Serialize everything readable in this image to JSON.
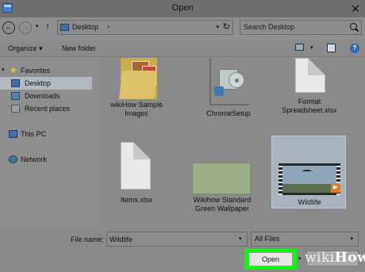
{
  "window": {
    "title": "Open",
    "close_glyph": "✕"
  },
  "address": {
    "location": "Desktop",
    "chevron": "›",
    "dropdown_glyph": "▾",
    "refresh_glyph": "↻"
  },
  "nav_buttons": {
    "back_glyph": "←",
    "forward_glyph": "→",
    "recent_glyph": "▾",
    "up_glyph": "↑"
  },
  "search": {
    "placeholder": "Search Desktop"
  },
  "toolbar": {
    "organize_label": "Organize",
    "organize_caret": "▾",
    "new_folder_label": "New folder",
    "view_drop_glyph": "▾",
    "help_glyph": "?"
  },
  "sidebar": {
    "items": [
      {
        "label": "Favorites",
        "caret": "▾",
        "icon": "★"
      },
      {
        "label": "Desktop"
      },
      {
        "label": "Downloads"
      },
      {
        "label": "Recent places"
      },
      {
        "label": "This PC"
      },
      {
        "label": "Network"
      }
    ]
  },
  "files": [
    {
      "name": "wikiHow Sample Images",
      "type": "folder"
    },
    {
      "name": "ChromeSetup",
      "type": "installer"
    },
    {
      "name": "Format Spreadsheet.xlsx",
      "type": "document"
    },
    {
      "name": "Items.xlsx",
      "type": "document"
    },
    {
      "name": "Wikihow Standard Green Wallpaper",
      "type": "image"
    },
    {
      "name": "Wildlife",
      "type": "video",
      "selected": true,
      "play_glyph": "▶"
    }
  ],
  "bottom": {
    "filename_label": "File name:",
    "filename_value": "Wildlife",
    "filename_drop_glyph": "▾",
    "filetype_value": "All Files",
    "filetype_drop_glyph": "▾",
    "open_label": "Open",
    "open_drop_glyph": "▾"
  },
  "watermark": {
    "prefix": "wiki",
    "suffix": "How"
  },
  "colors": {
    "highlight": "#00ff00",
    "selection": "#a8b3bd",
    "accent": "#2c6cb3"
  }
}
